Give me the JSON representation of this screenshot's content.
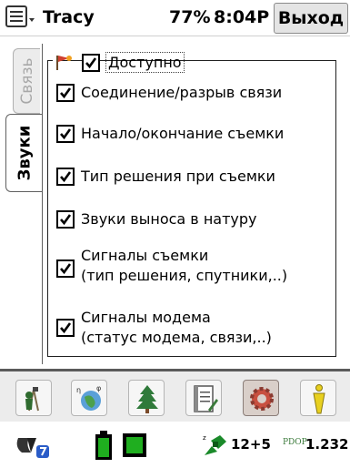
{
  "titlebar": {
    "app_title": "Tracy",
    "battery": "77%",
    "time": "8:04P",
    "exit_label": "Выход"
  },
  "tabs": [
    {
      "label": "Связь",
      "active": false
    },
    {
      "label": "Звуки",
      "active": true
    }
  ],
  "group": {
    "label": "Доступно",
    "checked": true
  },
  "options": [
    {
      "label": "Соединение/разрыв связи",
      "checked": true
    },
    {
      "label": "Начало/окончание съемки",
      "checked": true
    },
    {
      "label": "Тип решения при съемки",
      "checked": true
    },
    {
      "label": "Звуки выноса в натуру",
      "checked": true
    },
    {
      "label": "Сигналы съемки",
      "label2": "(тип решения, спутники,..)",
      "checked": true
    },
    {
      "label": "Сигналы модема",
      "label2": "(статус модема, связи,..)",
      "checked": true
    }
  ],
  "toolbar": {
    "icons": [
      "survey-icon",
      "globe-icon",
      "tree-icon",
      "notebook-icon",
      "settings-gear-icon",
      "info-icon"
    ],
    "active": "settings-gear-icon"
  },
  "status": {
    "satellites": "12+5",
    "pdop_label": "PDOP",
    "pdop_value": "1.232"
  },
  "colors": {
    "accent_green": "#1fae1f",
    "dark_green": "#2f6b2f",
    "gear_red": "#c85040",
    "info_yellow": "#e8d020"
  }
}
